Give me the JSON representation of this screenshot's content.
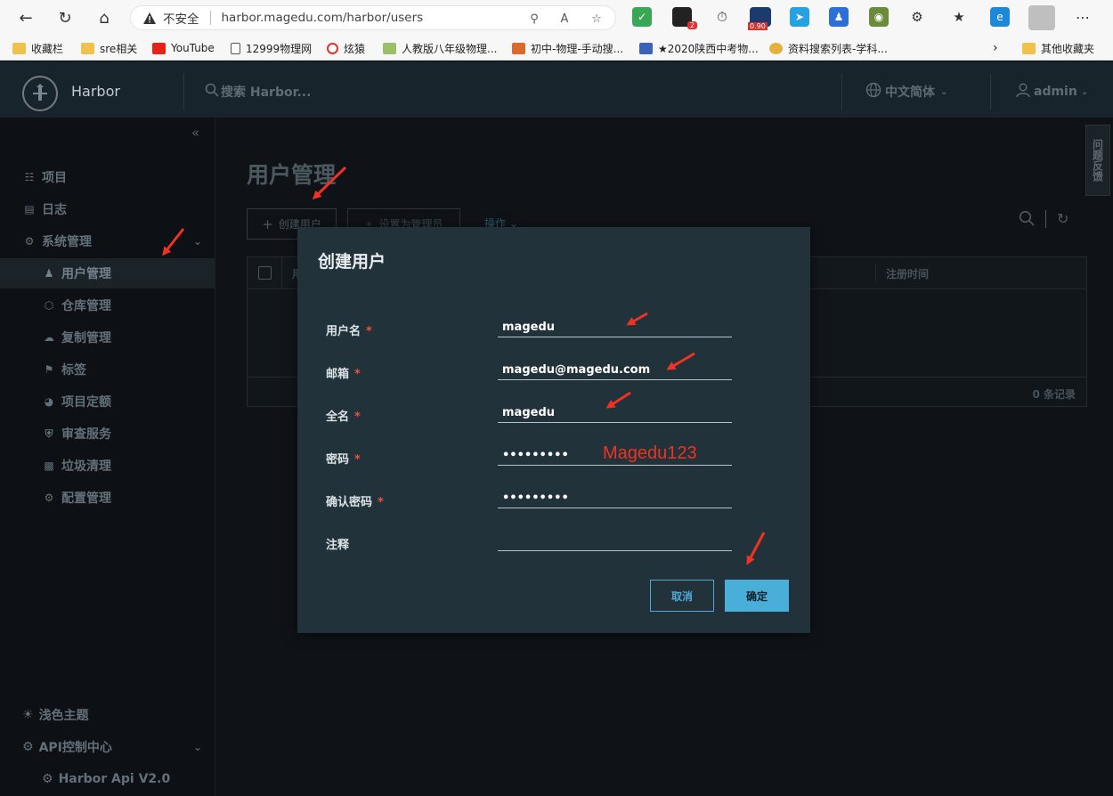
{
  "browser": {
    "insecure_label": "不安全",
    "url": "harbor.magedu.com/harbor/users",
    "ext_badge_count": "2",
    "ext_price": "0.90",
    "bookmarks": [
      {
        "label": "收藏栏"
      },
      {
        "label": "sre相关"
      },
      {
        "label": "YouTube"
      },
      {
        "label": "12999物理网"
      },
      {
        "label": "炫猿"
      },
      {
        "label": "人教版八年级物理..."
      },
      {
        "label": "初中-物理-手动搜..."
      },
      {
        "label": "★2020陕西中考物..."
      },
      {
        "label": "资料搜索列表-学科..."
      }
    ],
    "other_bookmarks": "其他收藏夹"
  },
  "header": {
    "brand": "Harbor",
    "search_placeholder": "搜索 Harbor...",
    "language": "中文简体",
    "username": "admin"
  },
  "sidebar": {
    "items": [
      {
        "label": "项目"
      },
      {
        "label": "日志"
      },
      {
        "label": "系统管理"
      },
      {
        "label": "用户管理"
      },
      {
        "label": "仓库管理"
      },
      {
        "label": "复制管理"
      },
      {
        "label": "标签"
      },
      {
        "label": "项目定额"
      },
      {
        "label": "审查服务"
      },
      {
        "label": "垃圾清理"
      },
      {
        "label": "配置管理"
      }
    ],
    "bottom": [
      {
        "label": "浅色主题"
      },
      {
        "label": "API控制中心"
      },
      {
        "label": "Harbor Api V2.0"
      }
    ]
  },
  "main": {
    "page_title": "用户管理",
    "create_user": "创建用户",
    "set_admin": "设置为管理员",
    "actions": "操作",
    "col_user": "用",
    "col_registered": "注册时间",
    "record_count": "0 条记录",
    "feedback": "问题反馈"
  },
  "modal": {
    "title": "创建用户",
    "fields": [
      {
        "label": "用户名",
        "required": true,
        "value": "magedu"
      },
      {
        "label": "邮箱",
        "required": true,
        "value": "magedu@magedu.com"
      },
      {
        "label": "全名",
        "required": true,
        "value": "magedu"
      },
      {
        "label": "密码",
        "required": true,
        "value": "•••••••••"
      },
      {
        "label": "确认密码",
        "required": true,
        "value": "•••••••••"
      },
      {
        "label": "注释",
        "required": false,
        "value": ""
      }
    ],
    "password_annotation": "Magedu123",
    "cancel": "取消",
    "ok": "确定"
  },
  "colors": {
    "accent": "#49afd9",
    "annotation_red": "#ee3322",
    "required_star": "#e4543c"
  }
}
